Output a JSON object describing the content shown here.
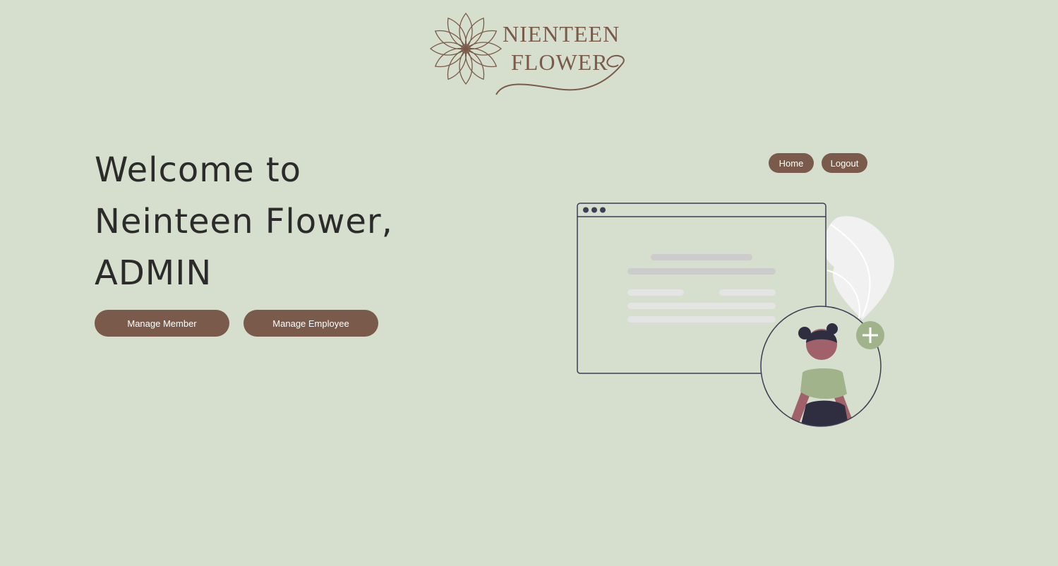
{
  "logo": {
    "line1": "NIENTEEN",
    "line2": "FLOWER"
  },
  "nav": {
    "home_label": "Home",
    "logout_label": "Logout"
  },
  "welcome": {
    "line1": "Welcome to",
    "line2": "Neinteen Flower,",
    "line3": "ADMIN"
  },
  "actions": {
    "manage_member_label": "Manage Member",
    "manage_employee_label": "Manage Employee"
  },
  "colors": {
    "background": "#d6dfcd",
    "accent": "#7a5a4a",
    "text": "#2b2b2b",
    "green": "#a0b38b"
  },
  "icons": {
    "flower": "flower-logo-icon",
    "plus": "plus-icon"
  }
}
